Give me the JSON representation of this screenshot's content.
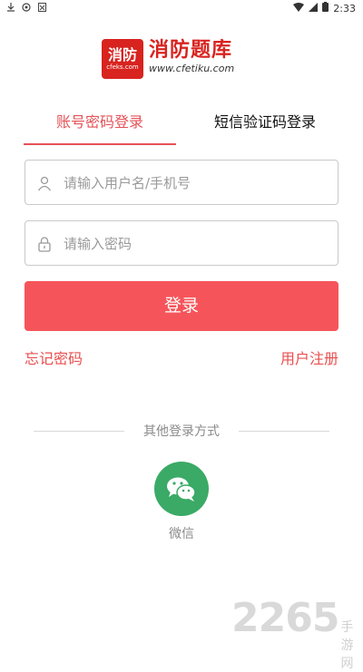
{
  "status_bar": {
    "time": "2:33"
  },
  "logo": {
    "badge_main": "消防",
    "badge_sub": "cfeks.com",
    "title": "消防题库",
    "url": "www.cfetiku.com"
  },
  "tabs": [
    {
      "label": "账号密码登录",
      "active": true
    },
    {
      "label": "短信验证码登录",
      "active": false
    }
  ],
  "form": {
    "username": {
      "value": "",
      "placeholder": "请输入用户名/手机号",
      "icon": "user-icon"
    },
    "password": {
      "value": "",
      "placeholder": "请输入密码",
      "icon": "lock-icon"
    },
    "login_label": "登录",
    "forgot_label": "忘记密码",
    "register_label": "用户注册"
  },
  "other_login": {
    "title": "其他登录方式",
    "wechat_label": "微信"
  },
  "watermark": {
    "number": "2265",
    "suffix": "手游网"
  },
  "colors": {
    "accent": "#f5555a",
    "wechat": "#3aaa66",
    "logo_red": "#d8231f"
  }
}
